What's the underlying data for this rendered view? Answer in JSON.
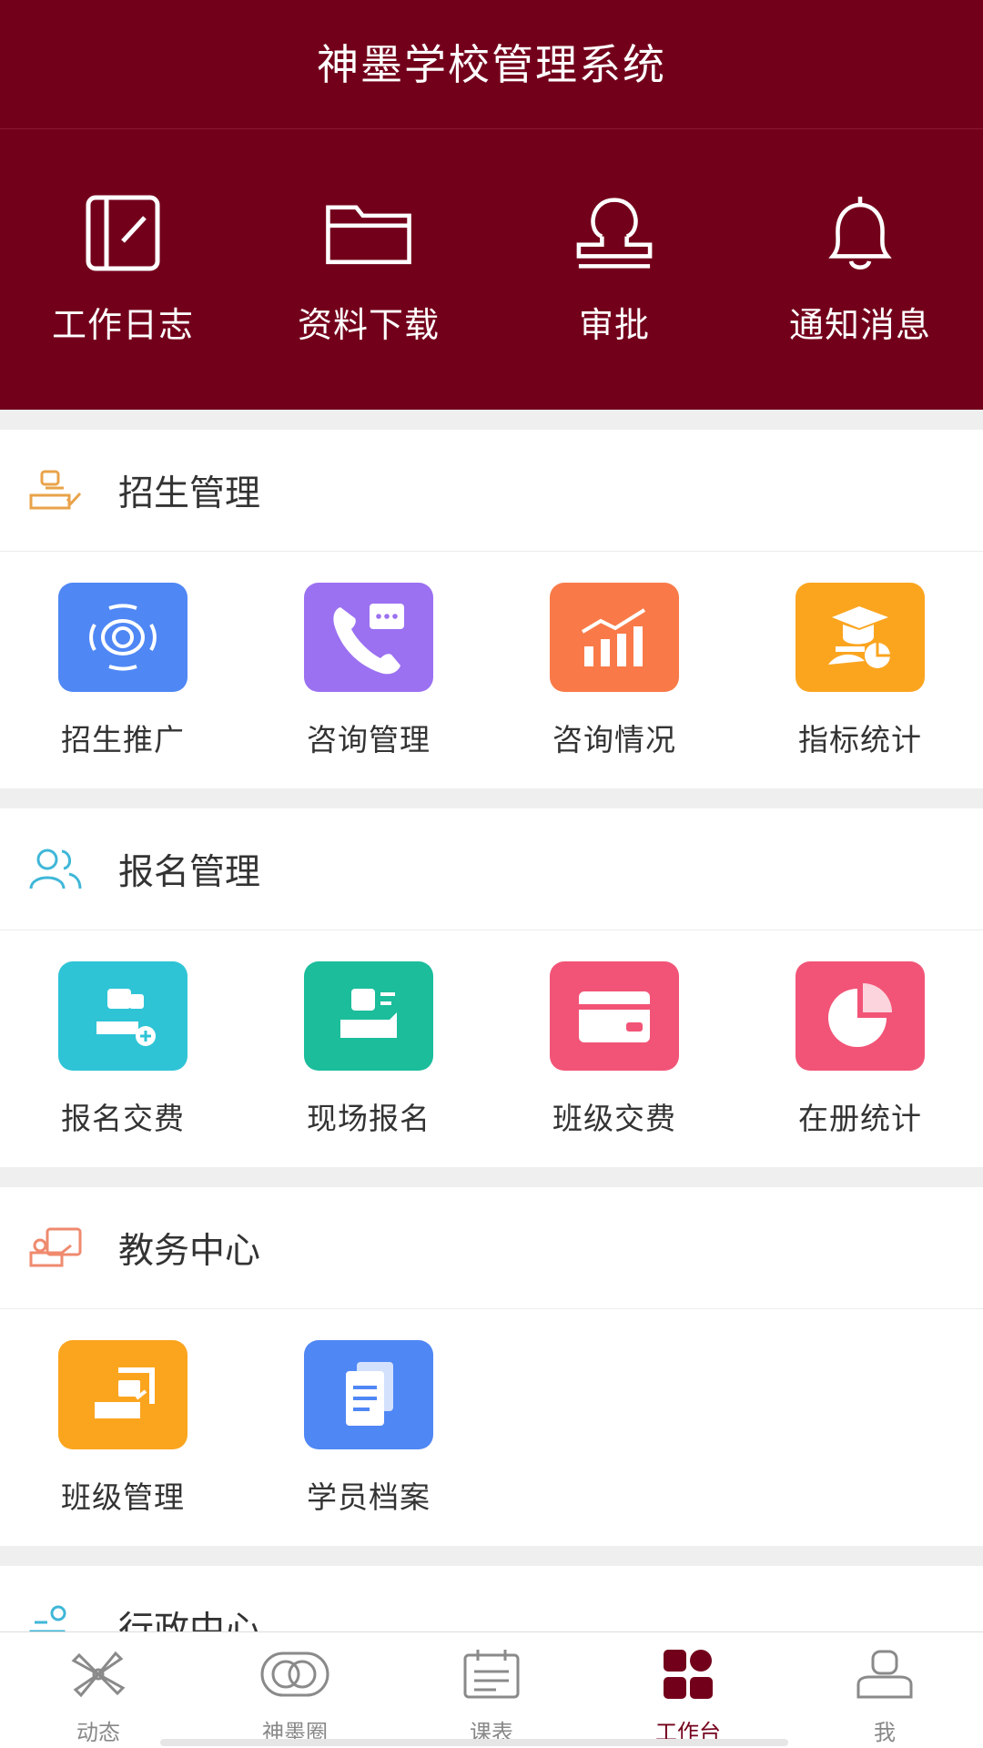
{
  "header": {
    "title": "神墨学校管理系统"
  },
  "quick_actions": [
    {
      "label": "工作日志",
      "icon": "journal-icon"
    },
    {
      "label": "资料下载",
      "icon": "folder-icon"
    },
    {
      "label": "审批",
      "icon": "stamp-icon"
    },
    {
      "label": "通知消息",
      "icon": "bell-icon"
    }
  ],
  "sections": [
    {
      "title": "招生管理",
      "icon": "enrollment-icon",
      "icon_color": "#e9a34a",
      "items": [
        {
          "label": "招生推广",
          "icon": "broadcast-icon",
          "color": "#4f87f5"
        },
        {
          "label": "咨询管理",
          "icon": "phone-chat-icon",
          "color": "#9b71f2"
        },
        {
          "label": "咨询情况",
          "icon": "bar-trend-icon",
          "color": "#f97a48"
        },
        {
          "label": "指标统计",
          "icon": "graduate-chart-icon",
          "color": "#fba51f"
        }
      ]
    },
    {
      "title": "报名管理",
      "icon": "users-icon",
      "icon_color": "#3fb7d8",
      "items": [
        {
          "label": "报名交费",
          "icon": "register-pay-icon",
          "color": "#2ec4d6"
        },
        {
          "label": "现场报名",
          "icon": "onsite-register-icon",
          "color": "#1bbd9b"
        },
        {
          "label": "班级交费",
          "icon": "card-icon",
          "color": "#f25477"
        },
        {
          "label": "在册统计",
          "icon": "pie-icon",
          "color": "#f25477"
        }
      ]
    },
    {
      "title": "教务中心",
      "icon": "teaching-icon",
      "icon_color": "#ef8a6e",
      "items": [
        {
          "label": "班级管理",
          "icon": "class-icon",
          "color": "#fba51f"
        },
        {
          "label": "学员档案",
          "icon": "files-icon",
          "color": "#4f87f5"
        }
      ]
    },
    {
      "title": "行政中心",
      "icon": "admin-icon",
      "icon_color": "#3fb7d8",
      "items": []
    }
  ],
  "tabs": [
    {
      "label": "动态",
      "icon": "pinwheel-icon",
      "active": false
    },
    {
      "label": "神墨圈",
      "icon": "circles-icon",
      "active": false
    },
    {
      "label": "课表",
      "icon": "calendar-icon",
      "active": false
    },
    {
      "label": "工作台",
      "icon": "grid-icon",
      "active": true
    },
    {
      "label": "我",
      "icon": "person-icon",
      "active": false
    }
  ]
}
